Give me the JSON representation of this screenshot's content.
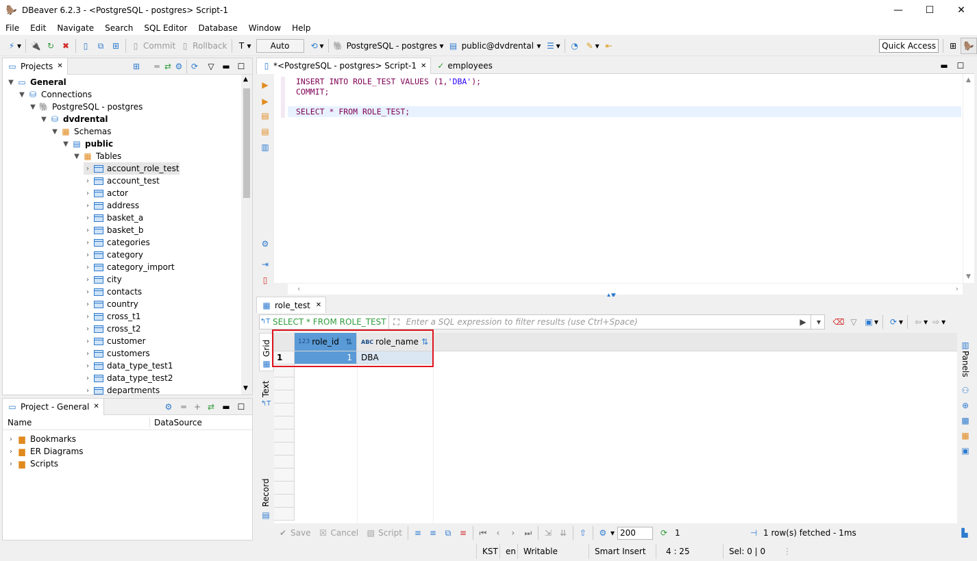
{
  "window": {
    "title": "DBeaver 6.2.3 - <PostgreSQL - postgres> Script-1"
  },
  "menu": [
    "File",
    "Edit",
    "Navigate",
    "Search",
    "SQL Editor",
    "Database",
    "Window",
    "Help"
  ],
  "toolbar": {
    "commit": "Commit",
    "rollback": "Rollback",
    "mode": "Auto",
    "connection": "PostgreSQL - postgres",
    "schema": "public@dvdrental",
    "quick_access": "Quick Access"
  },
  "projects_panel": {
    "tab": "Projects",
    "general": "General",
    "connections": "Connections",
    "connection": "PostgreSQL - postgres",
    "database": "dvdrental",
    "schemas": "Schemas",
    "schema": "public",
    "tables_folder": "Tables",
    "tables": [
      "account_role_test",
      "account_test",
      "actor",
      "address",
      "basket_a",
      "basket_b",
      "categories",
      "category",
      "category_import",
      "city",
      "contacts",
      "country",
      "cross_t1",
      "cross_t2",
      "customer",
      "customers",
      "data_type_test1",
      "data_type_test2",
      "departments"
    ]
  },
  "project_general": {
    "tab": "Project - General",
    "col_name": "Name",
    "col_datasource": "DataSource",
    "items": [
      "Bookmarks",
      "ER Diagrams",
      "Scripts"
    ]
  },
  "editor": {
    "tab_script": "*<PostgreSQL - postgres> Script-1",
    "tab_employees": "employees",
    "lines": [
      {
        "kw1": "INSERT INTO ",
        "id1": "ROLE_TEST ",
        "kw2": "VALUES ",
        "rest": "(1,",
        "str": "'DBA'",
        "end": ");"
      },
      {
        "kw1": "COMMIT",
        "end": ";"
      },
      {
        "kw1": "SELECT ",
        "id1": "* ",
        "kw2": "FROM ",
        "rest": "ROLE_TEST",
        "end": ";"
      }
    ]
  },
  "results": {
    "tab": "role_test",
    "query": "SELECT * FROM ROLE_TEST",
    "filter_placeholder": "Enter a SQL expression to filter results (use Ctrl+Space)",
    "side_tabs": [
      "Grid",
      "Text",
      "Record"
    ],
    "panels_label": "Panels",
    "columns": [
      {
        "type": "123",
        "name": "role_id"
      },
      {
        "type": "ABC",
        "name": "role_name"
      }
    ],
    "rows": [
      {
        "num": "1",
        "role_id": "1",
        "role_name": "DBA"
      }
    ],
    "bottom": {
      "save": "Save",
      "cancel": "Cancel",
      "script": "Script",
      "fetch_size": "200",
      "refresh_count": "1",
      "fetched": "1 row(s) fetched - 1ms"
    }
  },
  "statusbar": {
    "tz": "KST",
    "lang": "en",
    "mode": "Writable",
    "insert": "Smart Insert",
    "pos": "4 : 25",
    "sel": "Sel: 0 | 0"
  },
  "colors": {
    "highlight_box": "#e0141e",
    "selected_cell": "#5a9ad6",
    "keyword": "#7f0055",
    "string": "#2a00ff"
  }
}
